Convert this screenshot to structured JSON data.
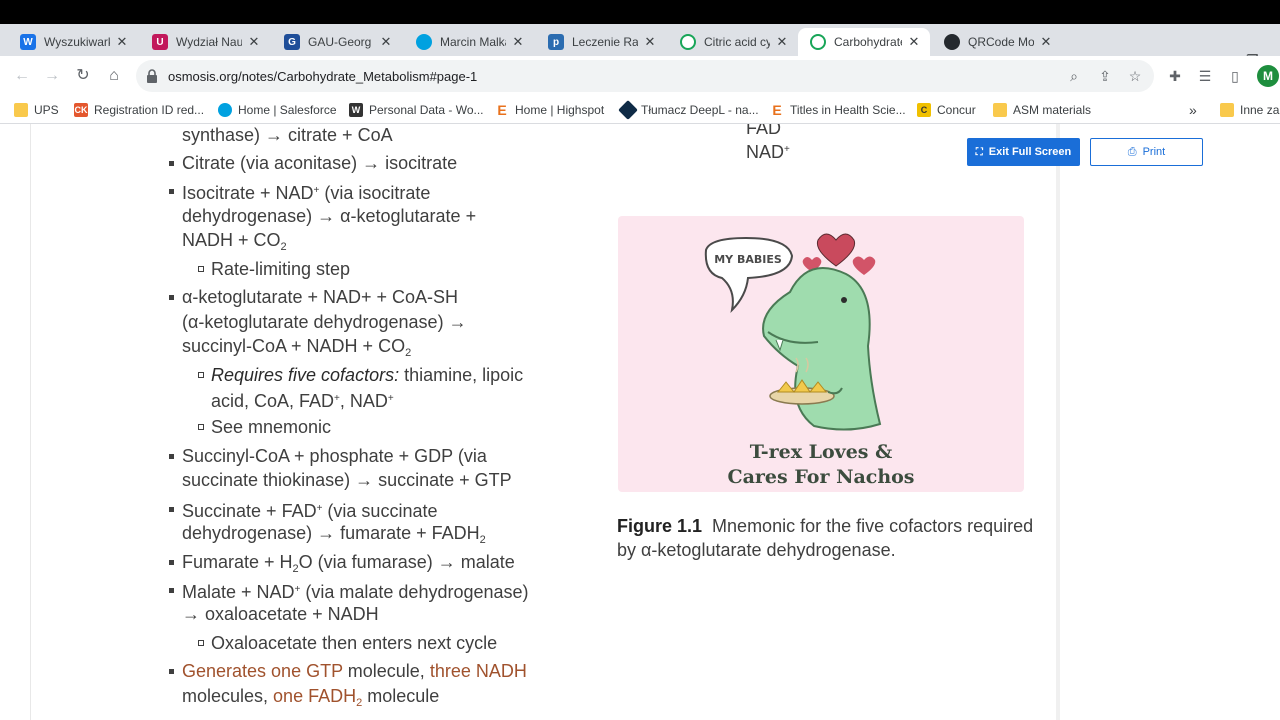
{
  "tabs": [
    {
      "label": "Wyszukiwark",
      "icon": "wyszukiwarka-favicon-icon",
      "color": "#1a73e8"
    },
    {
      "label": "Wydział Naul",
      "icon": "wydzial-favicon-icon",
      "color": "#c2185b"
    },
    {
      "label": "GAU-Georg",
      "icon": "gau-favicon-icon",
      "color": "#1f4e99"
    },
    {
      "label": "Marcin Malka",
      "icon": "cloud-favicon-icon",
      "color": "#00a1e0"
    },
    {
      "label": "Leczenie Ran",
      "icon": "p-favicon-icon",
      "color": "#2b6cb0"
    },
    {
      "label": "Citric acid cy",
      "icon": "osmosis-favicon-icon",
      "color": "#18a558"
    },
    {
      "label": "Carbohydrate",
      "icon": "osmosis-favicon-icon",
      "color": "#18a558"
    },
    {
      "label": "QRCode Mor",
      "icon": "github-favicon-icon",
      "color": "#24292e"
    }
  ],
  "address": {
    "url": "osmosis.org/notes/Carbohydrate_Metabolism#page-1"
  },
  "bookmarks": [
    {
      "label": "UPS",
      "icon": "folder-icon"
    },
    {
      "label": "Registration ID red...",
      "icon": "ck-favicon-icon"
    },
    {
      "label": "Home | Salesforce",
      "icon": "salesforce-cloud-icon"
    },
    {
      "label": "Personal Data - Wo...",
      "icon": "w-favicon-icon"
    },
    {
      "label": "Home | Highspot",
      "icon": "e-favicon-icon"
    },
    {
      "label": "Tłumacz DeepL - na...",
      "icon": "deepl-favicon-icon"
    },
    {
      "label": "Titles in Health Scie...",
      "icon": "e-favicon-icon"
    },
    {
      "label": "Concur",
      "icon": "concur-favicon-icon"
    },
    {
      "label": "ASM materials",
      "icon": "folder-icon"
    },
    {
      "label": "Inne zak",
      "icon": "folder-icon"
    }
  ],
  "overflow": "»",
  "buttons": {
    "exit": "Exit Full Screen",
    "print": "Print"
  },
  "notes": {
    "l1": "synthase) → citrate + CoA",
    "l2": "Citrate (via aconitase) → isocitrate",
    "l3a": "Isocitrate + NAD",
    "l3b": " (via isocitrate",
    "l4": "dehydrogenase) → α-ketoglutarate +",
    "l5a": "NADH + CO",
    "l6": "Rate-limiting step",
    "l7": "α-ketoglutarate + NAD+ + CoA-SH",
    "l8": "(α-ketoglutarate dehydrogenase) →",
    "l9a": "succinyl-CoA + NADH + CO",
    "l10a": "Requires five cofactors:",
    "l10b": " thiamine, lipoic",
    "l11a": "acid, CoA, FAD",
    "l11b": ", NAD",
    "l12": "See mnemonic",
    "l13": "Succinyl-CoA + phosphate + GDP (via",
    "l14": "succinate thiokinase) → succinate + GTP",
    "l15a": "Succinate + FAD",
    "l15b": " (via succinate",
    "l16a": "dehydrogenase) → fumarate + FADH",
    "l17a": "Fumarate + H",
    "l17b": "O (via fumarase) → malate",
    "l18a": "Malate + NAD",
    "l18b": " (via malate dehydrogenase)",
    "l19": "→ oxaloacetate + NADH",
    "l20": "Oxaloacetate then enters next cycle",
    "l21a": "Generates one GTP",
    "l21b": " molecule, ",
    "l21c": "three NADH",
    "l22a": "molecules, ",
    "l22b": "one FADH",
    "l22c": " molecule",
    "sub2": "2",
    "supplus": "+"
  },
  "right": {
    "fad_partial": "FAD",
    "nad": "NAD",
    "figure_speech": "MY BABIES",
    "figure_line1": "T-rex Loves &",
    "figure_line2": "Cares For Nachos",
    "caption_label": "Figure 1.1",
    "caption_text": "Mnemonic for the five cofactors required by α-ketoglutarate dehydrogenase."
  },
  "profile_initial": "M"
}
